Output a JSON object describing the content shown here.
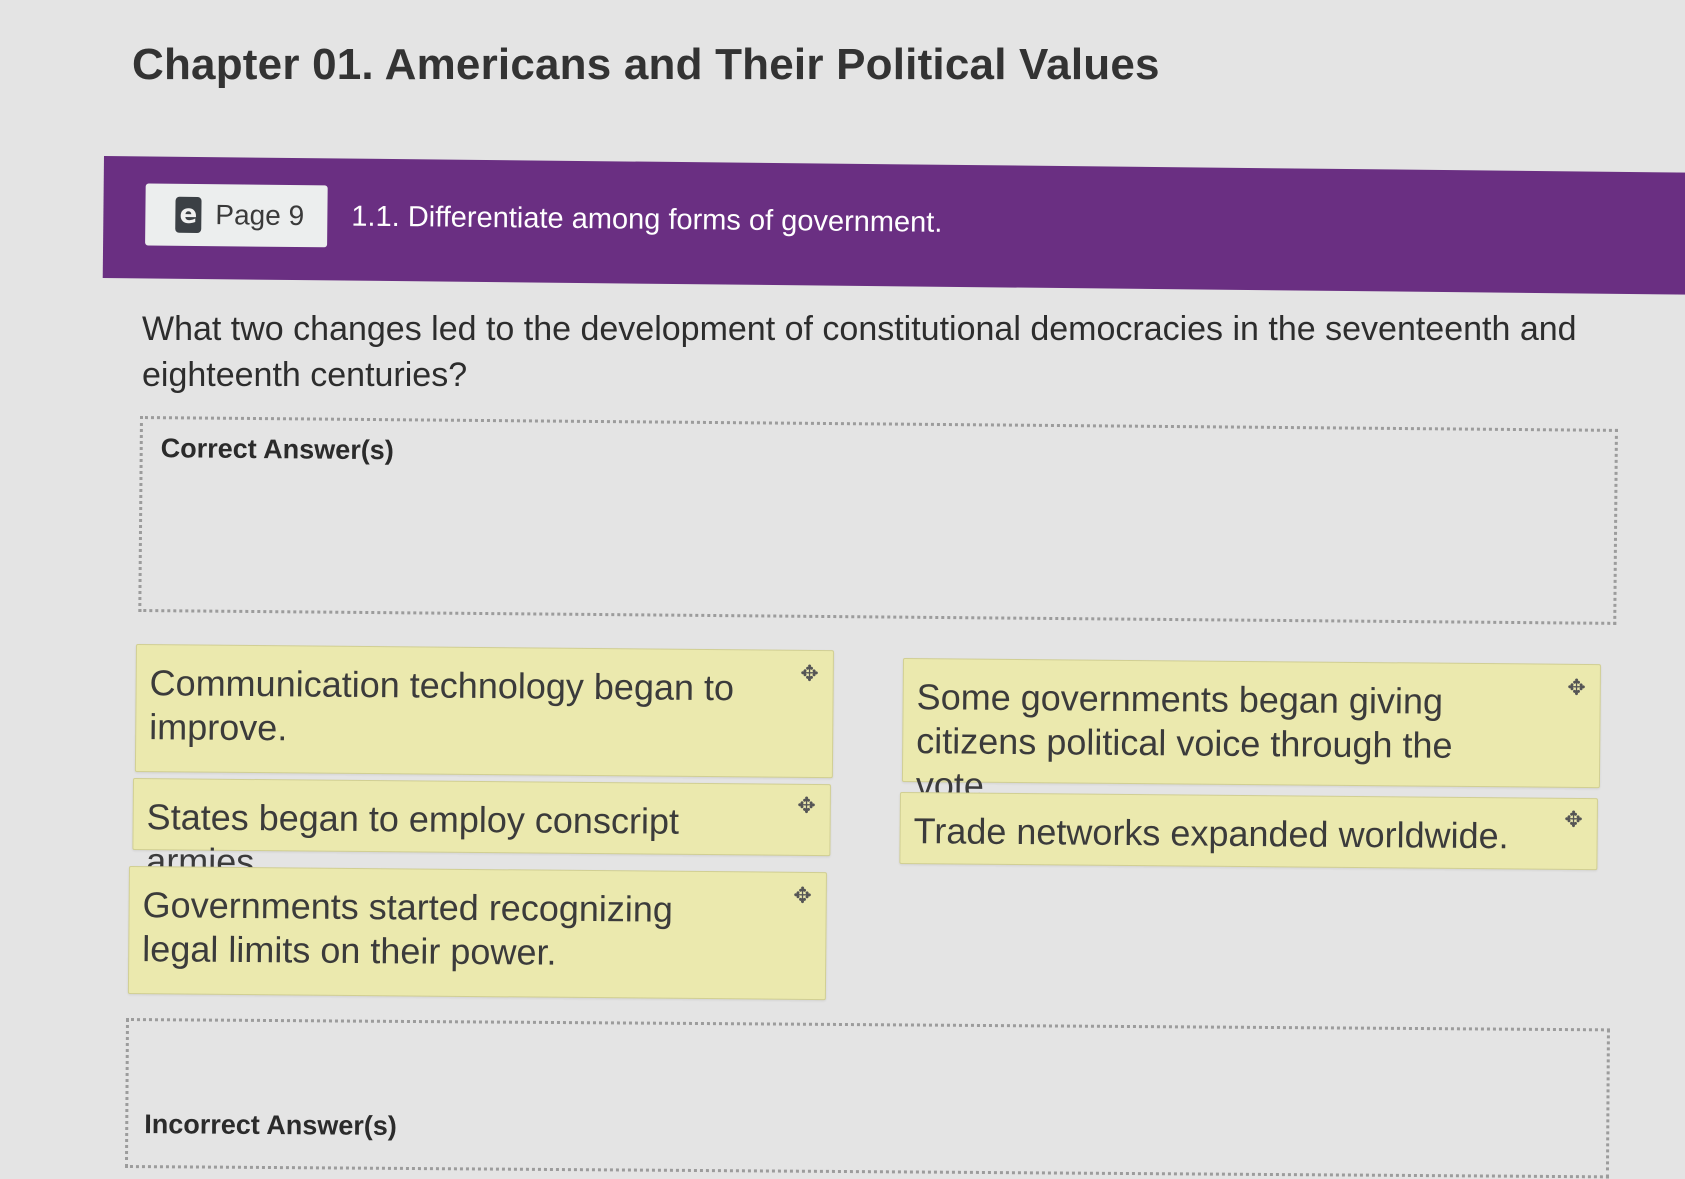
{
  "header": {
    "title": "Chapter 01. Americans and Their Political Values"
  },
  "objective": {
    "page_label": "Page 9",
    "ebook_icon_glyph": "e",
    "text": "1.1. Differentiate among forms of government.",
    "banner_color": "#6a2f82"
  },
  "question": {
    "text": "What two changes led to the development of constitutional democracies in the seventeenth and eighteenth centuries?"
  },
  "zones": {
    "correct_label": "Correct Answer(s)",
    "incorrect_label": "Incorrect Answer(s)"
  },
  "cards": [
    {
      "text": "Communication technology began to improve.",
      "icon": "move-icon"
    },
    {
      "text": "Some governments began giving citizens political voice through the vote.",
      "icon": "move-icon"
    },
    {
      "text": "States began to employ conscript armies.",
      "icon": "move-icon"
    },
    {
      "text": "Trade networks expanded worldwide.",
      "icon": "move-icon"
    },
    {
      "text": "Governments started recognizing legal limits on their power.",
      "icon": "move-icon"
    }
  ],
  "card_color": "#ebe9ae",
  "drag_glyph": "✥"
}
